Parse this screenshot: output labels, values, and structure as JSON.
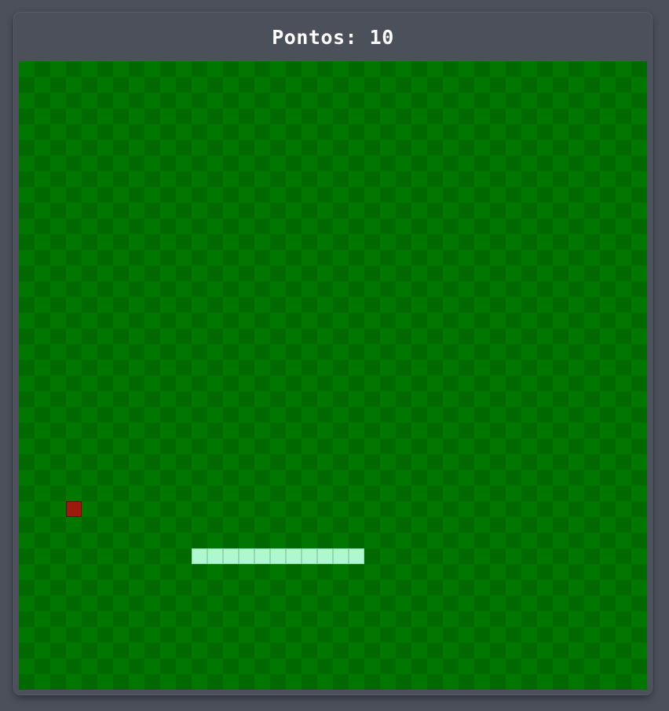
{
  "score": {
    "label": "Pontos:",
    "value": "10"
  },
  "board": {
    "cols": 40,
    "rows": 40,
    "colors": {
      "light": "#007800",
      "dark": "#006a00"
    }
  },
  "food": {
    "col": 3,
    "row": 28,
    "color": "#9a1a0e"
  },
  "snake": {
    "color": "#aef7cf",
    "segments": [
      {
        "col": 21,
        "row": 31
      },
      {
        "col": 20,
        "row": 31
      },
      {
        "col": 19,
        "row": 31
      },
      {
        "col": 18,
        "row": 31
      },
      {
        "col": 17,
        "row": 31
      },
      {
        "col": 16,
        "row": 31
      },
      {
        "col": 15,
        "row": 31
      },
      {
        "col": 14,
        "row": 31
      },
      {
        "col": 13,
        "row": 31
      },
      {
        "col": 12,
        "row": 31
      },
      {
        "col": 11,
        "row": 31
      }
    ]
  }
}
